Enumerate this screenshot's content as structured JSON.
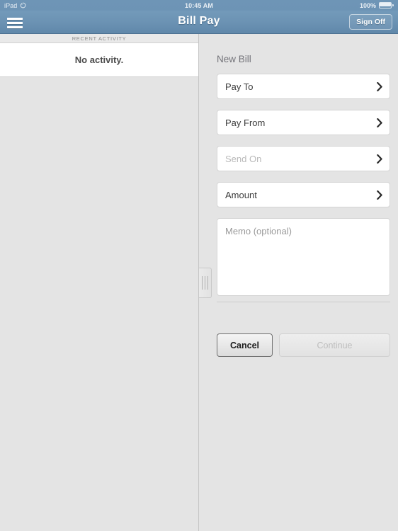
{
  "status_bar": {
    "device": "iPad",
    "rotation_lock_icon": "rotation-lock-icon",
    "time": "10:45 AM",
    "battery_percent": "100%",
    "battery_icon": "battery-icon"
  },
  "nav_bar": {
    "menu_icon": "hamburger-menu-icon",
    "title": "Bill Pay",
    "sign_off_label": "Sign Off"
  },
  "left_pane": {
    "section_header": "RECENT ACTIVITY",
    "empty_message": "No activity."
  },
  "splitter": {
    "grip_icon": "drag-handle-icon"
  },
  "new_bill": {
    "title": "New Bill",
    "fields": [
      {
        "label": "Pay To",
        "state": "empty",
        "chevron": "chevron-right-icon"
      },
      {
        "label": "Pay From",
        "state": "empty",
        "chevron": "chevron-right-icon"
      },
      {
        "label": "Send On",
        "state": "placeholder",
        "chevron": "chevron-right-icon"
      },
      {
        "label": "Amount",
        "state": "empty",
        "chevron": "chevron-right-icon"
      }
    ],
    "memo_placeholder": "Memo (optional)",
    "cancel_label": "Cancel",
    "continue_label": "Continue"
  },
  "colors": {
    "nav_bar_blue": "#6b92b3",
    "page_background": "#e4e4e4",
    "card_white": "#ffffff",
    "field_border": "#d4d4d4",
    "placeholder_text": "#b9b9b9",
    "disabled_text": "#bdbdbd"
  }
}
